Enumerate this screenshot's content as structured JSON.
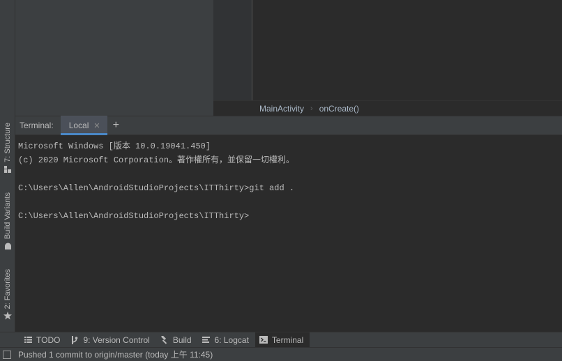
{
  "left_strip": {
    "structure_label": "7: Structure",
    "build_variants_label": "Build Variants",
    "favorites_label": "2: Favorites"
  },
  "breadcrumb": {
    "class_name": "MainActivity",
    "method_name": "onCreate()"
  },
  "terminal": {
    "title": "Terminal:",
    "tab_label": "Local",
    "lines": [
      "Microsoft Windows [版本 10.0.19041.450]",
      "(c) 2020 Microsoft Corporation。著作權所有，並保留一切權利。",
      "",
      "C:\\Users\\Allen\\AndroidStudioProjects\\ITThirty>git add .",
      "",
      "C:\\Users\\Allen\\AndroidStudioProjects\\ITThirty>"
    ]
  },
  "tool_windows": {
    "todo": "TODO",
    "version_control": "9: Version Control",
    "build": "Build",
    "logcat": "6: Logcat",
    "terminal": "Terminal"
  },
  "status": {
    "message": "Pushed 1 commit to origin/master (today 上午 11:45)"
  },
  "colors": {
    "panel": "#3c3f41",
    "editor": "#2b2b2b",
    "tab_underline": "#4a88c7",
    "text": "#bbbbbb"
  }
}
